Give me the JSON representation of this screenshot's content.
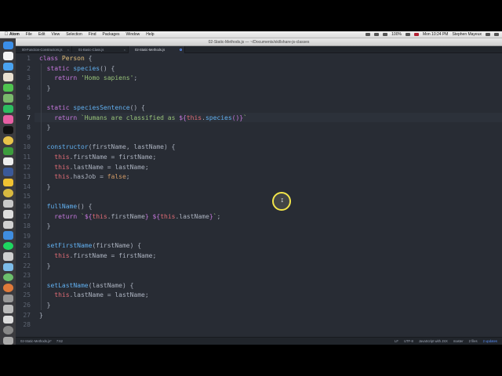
{
  "menubar": {
    "apple": "",
    "app": "Atom",
    "items": [
      "File",
      "Edit",
      "View",
      "Selection",
      "Find",
      "Packages",
      "Window",
      "Help"
    ],
    "battery": "100%",
    "clock": "Mon 10:24 PM",
    "user": "Stephen Mayeux"
  },
  "window": {
    "title": "02-Static-Methods.js — ~/Documents/skillshare-js-classes"
  },
  "tabs": [
    {
      "label": "00-Function-Constructors.js",
      "active": false
    },
    {
      "label": "01-Basic-Class.js",
      "active": false
    },
    {
      "label": "02-Static-Methods.js",
      "active": true
    }
  ],
  "editor": {
    "current_line": 7,
    "line_numbers": [
      "1",
      "2",
      "3",
      "4",
      "5",
      "6",
      "7",
      "8",
      "9",
      "10",
      "11",
      "12",
      "13",
      "14",
      "15",
      "16",
      "17",
      "18",
      "19",
      "20",
      "21",
      "22",
      "23",
      "24",
      "25",
      "26",
      "27",
      "28"
    ]
  },
  "code": {
    "l1": {
      "kw": "class",
      "name": " Person",
      "rest": " {"
    },
    "l2": {
      "kw": "static",
      "fn": " species",
      "rest": "() {"
    },
    "l3": {
      "kw": "return",
      "str": " 'Homo sapiens'",
      "rest": ";"
    },
    "l4": "}",
    "l6": {
      "kw": "static",
      "fn": " speciesSentence",
      "rest": "() {"
    },
    "l7": {
      "kw": "return",
      "str": " `Humans are classified as ",
      "tpl_open": "${",
      "this": "this",
      "dot": ".",
      "fn": "species",
      "tpl_rest": "()}",
      "tick": "`"
    },
    "l8": "}",
    "l10": {
      "fn": "constructor",
      "open": "(",
      "p1": "firstName",
      "comma": ", ",
      "p2": "lastName",
      "rest": ") {"
    },
    "l11": {
      "this": "this",
      "prop": ".firstName",
      "rest": " = firstName;"
    },
    "l12": {
      "this": "this",
      "prop": ".lastName",
      "rest": " = lastName;"
    },
    "l13": {
      "this": "this",
      "prop": ".hasJob",
      "eq": " = ",
      "val": "false",
      "rest": ";"
    },
    "l14": "}",
    "l16": {
      "fn": "fullName",
      "rest": "() {"
    },
    "l17": {
      "kw": "return",
      "s1": " `",
      "o1": "${",
      "t1": "this",
      "p1": ".firstName",
      "c1": "}",
      "s2": " ",
      "o2": "${",
      "t2": "this",
      "p2": ".lastName",
      "c2": "}",
      "s3": "`",
      "rest": ";"
    },
    "l18": "}",
    "l20": {
      "fn": "setFirstName",
      "open": "(",
      "p": "firstName",
      "rest": ") {"
    },
    "l21": {
      "this": "this",
      "prop": ".firstName",
      "rest": " = firstName;"
    },
    "l22": "}",
    "l24": {
      "fn": "setLastName",
      "open": "(",
      "p": "lastName",
      "rest": ") {"
    },
    "l25": {
      "this": "this",
      "prop": ".lastName",
      "rest": " = lastName;"
    },
    "l26": "}",
    "l27": "}"
  },
  "status": {
    "file": "02-Static-Methods.js*",
    "position": "7:62",
    "line_ending": "LF",
    "encoding": "UTF-8",
    "grammar": "JavaScript with JSX",
    "branch": "master",
    "files": "2 files",
    "updates": "2 updates"
  },
  "colors": {
    "editor_bg": "#282c34",
    "keyword": "#c678dd",
    "function": "#61afef",
    "string": "#98c379",
    "this": "#e06c75",
    "class": "#e5c07b",
    "cursor_ring": "#f2e54a"
  },
  "dock_icons": [
    "finder-icon",
    "calendar-icon",
    "mail-icon",
    "photos-icon",
    "messages-icon",
    "maps-icon",
    "evernote-icon",
    "itunes-icon",
    "terminal-icon",
    "chrome-icon",
    "vpn-icon",
    "sketch-icon",
    "facebook-icon",
    "drive-icon",
    "chrome-canary-icon",
    "sequel-icon",
    "github-icon",
    "slack-icon",
    "xcode-icon",
    "spotify-icon",
    "monodraw-icon",
    "skype-icon",
    "atom-icon",
    "screenflow-icon",
    "keynote-icon",
    "firefox-icon",
    "printer-icon",
    "screen-icon",
    "disk-icon",
    "trash-icon"
  ]
}
